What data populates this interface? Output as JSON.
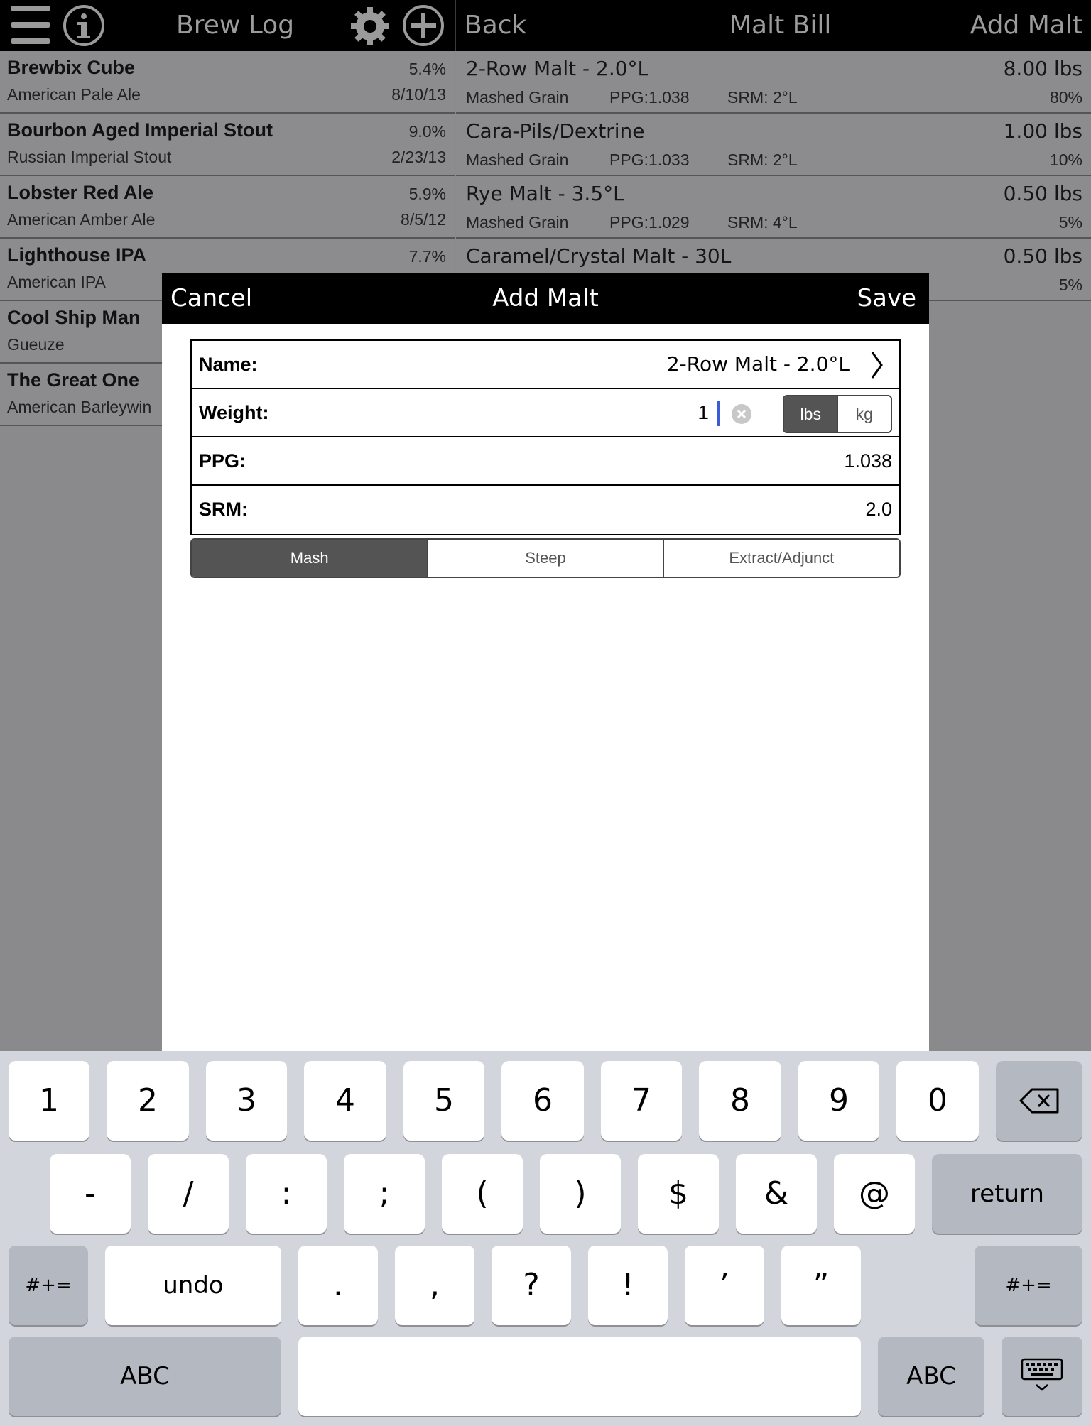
{
  "left_nav": {
    "title": "Brew Log",
    "icons": [
      "menu-icon",
      "info-icon",
      "gear-icon",
      "add-icon"
    ]
  },
  "right_nav": {
    "back": "Back",
    "title": "Malt Bill",
    "action": "Add Malt"
  },
  "brews": [
    {
      "name": "Brewbix Cube",
      "style": "American Pale Ale",
      "abv": "5.4%",
      "date": "8/10/13"
    },
    {
      "name": "Bourbon Aged Imperial Stout",
      "style": "Russian Imperial Stout",
      "abv": "9.0%",
      "date": "2/23/13"
    },
    {
      "name": "Lobster Red Ale",
      "style": "American Amber Ale",
      "abv": "5.9%",
      "date": "8/5/12"
    },
    {
      "name": "Lighthouse IPA",
      "style": "American IPA",
      "abv": "7.7%",
      "date": ""
    },
    {
      "name": "Cool Ship Man",
      "style": "Gueuze",
      "abv": "",
      "date": ""
    },
    {
      "name": "The Great One",
      "style": "American Barleywin",
      "abv": "",
      "date": ""
    }
  ],
  "malts": [
    {
      "name": "2-Row Malt - 2.0°L",
      "type": "Mashed Grain",
      "ppg": "PPG:1.038",
      "srm": "SRM: 2°L",
      "weight": "8.00 lbs",
      "pct": "80%"
    },
    {
      "name": "Cara-Pils/Dextrine",
      "type": "Mashed Grain",
      "ppg": "PPG:1.033",
      "srm": "SRM: 2°L",
      "weight": "1.00 lbs",
      "pct": "10%"
    },
    {
      "name": "Rye Malt - 3.5°L",
      "type": "Mashed Grain",
      "ppg": "PPG:1.029",
      "srm": "SRM: 4°L",
      "weight": "0.50 lbs",
      "pct": "5%"
    },
    {
      "name": "Caramel/Crystal Malt - 30L",
      "type": "",
      "ppg": "",
      "srm": "",
      "weight": "0.50 lbs",
      "pct": "5%"
    }
  ],
  "modal": {
    "cancel": "Cancel",
    "title": "Add Malt",
    "save": "Save",
    "name_label": "Name:",
    "name_value": "2-Row Malt - 2.0°L",
    "weight_label": "Weight:",
    "weight_value": "1",
    "unit_lbs": "lbs",
    "unit_kg": "kg",
    "unit_selected": "lbs",
    "ppg_label": "PPG:",
    "ppg_value": "1.038",
    "srm_label": "SRM:",
    "srm_value": "2.0",
    "types": [
      "Mash",
      "Steep",
      "Extract/Adjunct"
    ],
    "type_selected": "Mash"
  },
  "keyboard": {
    "row1": [
      "1",
      "2",
      "3",
      "4",
      "5",
      "6",
      "7",
      "8",
      "9",
      "0"
    ],
    "row2": [
      "-",
      "/",
      ":",
      ";",
      "(",
      ")",
      "$",
      "&",
      "@"
    ],
    "return": "return",
    "shift_label": "#+=",
    "undo": "undo",
    "row3": [
      ".",
      ",",
      "?",
      "!",
      "’",
      "”"
    ],
    "abc": "ABC",
    "icons": [
      "backspace-icon",
      "hide-keyboard-icon"
    ]
  },
  "colors": {
    "nav_bg": "#000000",
    "list_bg": "#8c8c8e",
    "accent_caret": "#3b5bdb",
    "segment_on": "#545454",
    "keyboard_bg": "#d2d5db"
  }
}
